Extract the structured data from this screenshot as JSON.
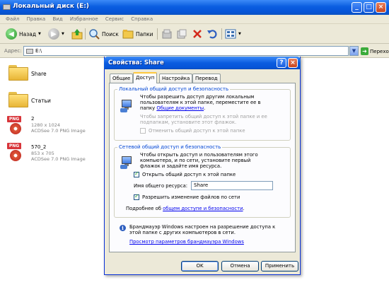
{
  "window": {
    "title": "Локальный диск (E:)",
    "controls": [
      "_",
      "□",
      "×"
    ]
  },
  "menu": [
    "Файл",
    "Правка",
    "Вид",
    "Избранное",
    "Сервис",
    "Справка"
  ],
  "toolbar": {
    "back": "Назад",
    "search": "Поиск",
    "folders": "Папки"
  },
  "address": {
    "label": "Адрес:",
    "value": "E:\\",
    "go": "Переход"
  },
  "files": [
    {
      "name": "Share",
      "type": "folder"
    },
    {
      "name": "Статьи",
      "type": "folder"
    },
    {
      "name": "2",
      "dims": "1280 x 1024",
      "app": "ACDSee 7.0 PNG Image",
      "type": "png",
      "badge": "PNG"
    },
    {
      "name": "570_2",
      "dims": "853 x 705",
      "app": "ACDSee 7.0 PNG Image",
      "type": "png",
      "badge": "PNG"
    }
  ],
  "dialog": {
    "title": "Свойства: Share",
    "help": "?",
    "close": "×",
    "tabs": [
      "Общие",
      "Доступ",
      "Настройка",
      "Перевод"
    ],
    "local": {
      "group": "Локальный общий доступ и безопасность",
      "text1": "Чтобы разрешить доступ другим локальным",
      "text2": "пользователям к этой папке, переместите ее в",
      "text3_pre": "папку ",
      "text3_link": "Общие документы",
      "text3_post": ".",
      "text4": "Чтобы запретить общий доступ к этой папке и ее",
      "text5": "подпапкам, установите этот флажок.",
      "checkbox": "Отменить общий доступ к этой папке"
    },
    "network": {
      "group": "Сетевой общий доступ и безопасность",
      "text1": "Чтобы открыть доступ и пользователям этого",
      "text2": "компьютера, и по сети, установите первый",
      "text3": "флажок и задайте имя ресурса.",
      "share_checkbox": "Открыть общий доступ к этой папке",
      "share_name_label": "Имя общего ресурса:",
      "share_name_value": "Share",
      "modify_checkbox": "Разрешить изменение файлов по сети",
      "more_pre": "Подробнее об ",
      "more_link": "общем доступе и безопасности",
      "more_post": "."
    },
    "firewall": {
      "icon": "i",
      "text1": "Брандмауэр Windows настроен на разрешение доступа к",
      "text2": "этой папке с других компьютеров в сети.",
      "link": "Просмотр параметров брандмауэра Windows"
    },
    "buttons": {
      "ok": "OK",
      "cancel": "Отмена",
      "apply": "Применить"
    }
  }
}
